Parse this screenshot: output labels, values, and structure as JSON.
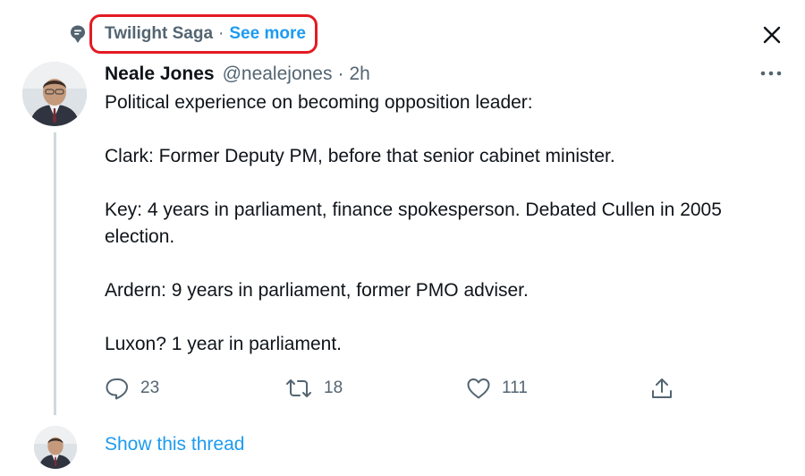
{
  "topic": {
    "name": "Twilight Saga",
    "separator": "·",
    "see_more": "See more"
  },
  "tweet": {
    "author_name": "Neale Jones",
    "handle": "@nealejones",
    "separator": "·",
    "time": "2h",
    "text": [
      "Political experience on becoming opposition leader:",
      "Clark: Former Deputy PM, before that senior cabinet minister.",
      "Key: 4 years in parliament, finance spokesperson. Debated Cullen in 2005 election.",
      "Ardern: 9 years in parliament, former PMO adviser.",
      "Luxon? 1 year in parliament."
    ],
    "stats": {
      "replies": "23",
      "retweets": "18",
      "likes": "111"
    }
  },
  "show_thread": "Show this thread",
  "icons": [
    "topic-icon",
    "close-icon",
    "more-icon",
    "reply-icon",
    "retweet-icon",
    "like-icon",
    "share-icon"
  ],
  "colors": {
    "accent": "#1d9bf0",
    "highlight_box": "#e31b23",
    "secondary_text": "#536471"
  }
}
